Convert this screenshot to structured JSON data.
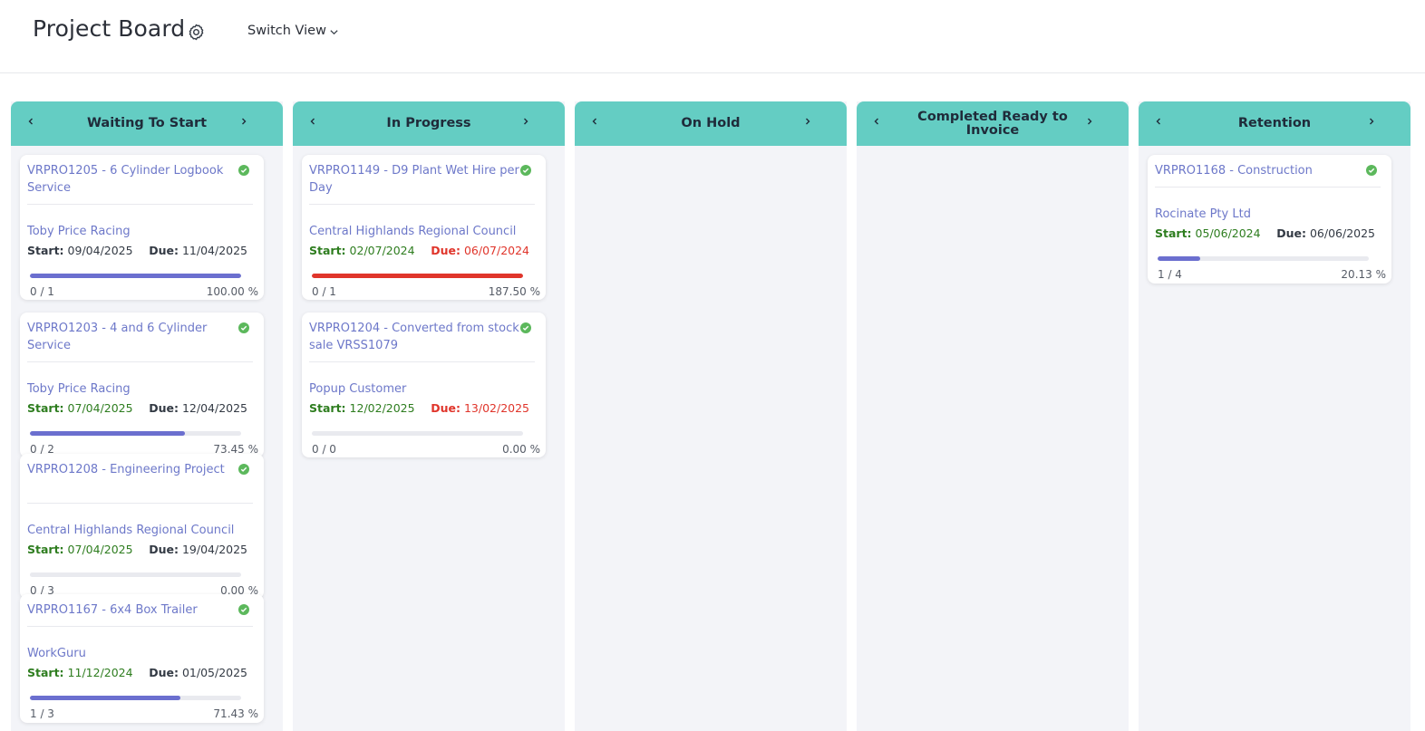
{
  "header": {
    "title": "Project Board",
    "switch_view": "Switch View"
  },
  "colors": {
    "column_header": "#64cdc3",
    "link": "#6d78c9",
    "progress": "#6b6fcf",
    "overdue": "#e0352b",
    "start": "#2e7d1f"
  },
  "columns": [
    {
      "title": "Waiting To Start",
      "cards": [
        {
          "code": "VRPRO1205",
          "name": "6 Cylinder Logbook Service",
          "customer": "Toby Price Racing",
          "start_label": "Start:",
          "start": "09/04/2025",
          "due_label": "Due:",
          "due": "11/04/2025",
          "count": "0 / 1",
          "percent": "100.00 %",
          "progress": 1.0,
          "overdue": false,
          "start_green": false
        },
        {
          "code": "VRPRO1203",
          "name": "4 and 6 Cylinder Service",
          "customer": "Toby Price Racing",
          "start_label": "Start:",
          "start": "07/04/2025",
          "due_label": "Due:",
          "due": "12/04/2025",
          "count": "0 / 2",
          "percent": "73.45 %",
          "progress": 0.7345,
          "overdue": false,
          "start_green": true
        },
        {
          "code": "VRPRO1208",
          "name": "Engineering Project",
          "customer": "Central Highlands Regional Council",
          "start_label": "Start:",
          "start": "07/04/2025",
          "due_label": "Due:",
          "due": "19/04/2025",
          "count": "0 / 3",
          "percent": "0.00 %",
          "progress": 0,
          "overdue": false,
          "start_green": true
        },
        {
          "code": "VRPRO1167",
          "name": "6x4 Box Trailer",
          "customer": "WorkGuru",
          "start_label": "Start:",
          "start": "11/12/2024",
          "due_label": "Due:",
          "due": "01/05/2025",
          "count": "1 / 3",
          "percent": "71.43 %",
          "progress": 0.7143,
          "overdue": false,
          "start_green": true
        }
      ]
    },
    {
      "title": "In Progress",
      "cards": [
        {
          "code": "VRPRO1149",
          "name": "D9 Plant Wet Hire per Day",
          "customer": "Central Highlands Regional Council",
          "start_label": "Start:",
          "start": "02/07/2024",
          "due_label": "Due:",
          "due": "06/07/2024",
          "count": "0 / 1",
          "percent": "187.50 %",
          "progress": 1.0,
          "overdue": true,
          "start_green": true
        },
        {
          "code": "VRPRO1204",
          "name": "Converted from stock sale VRSS1079",
          "customer": "Popup Customer",
          "start_label": "Start:",
          "start": "12/02/2025",
          "due_label": "Due:",
          "due": "13/02/2025",
          "count": "0 / 0",
          "percent": "0.00 %",
          "progress": 0,
          "overdue": true,
          "start_green": true
        }
      ]
    },
    {
      "title": "On Hold",
      "cards": []
    },
    {
      "title": "Completed Ready to Invoice",
      "cards": []
    },
    {
      "title": "Retention",
      "cards": [
        {
          "code": "VRPRO1168",
          "name": "Construction",
          "customer": "Rocinate Pty Ltd",
          "start_label": "Start:",
          "start": "05/06/2024",
          "due_label": "Due:",
          "due": "06/06/2025",
          "count": "1 / 4",
          "percent": "20.13 %",
          "progress": 0.2013,
          "overdue": false,
          "start_green": true
        }
      ]
    }
  ]
}
